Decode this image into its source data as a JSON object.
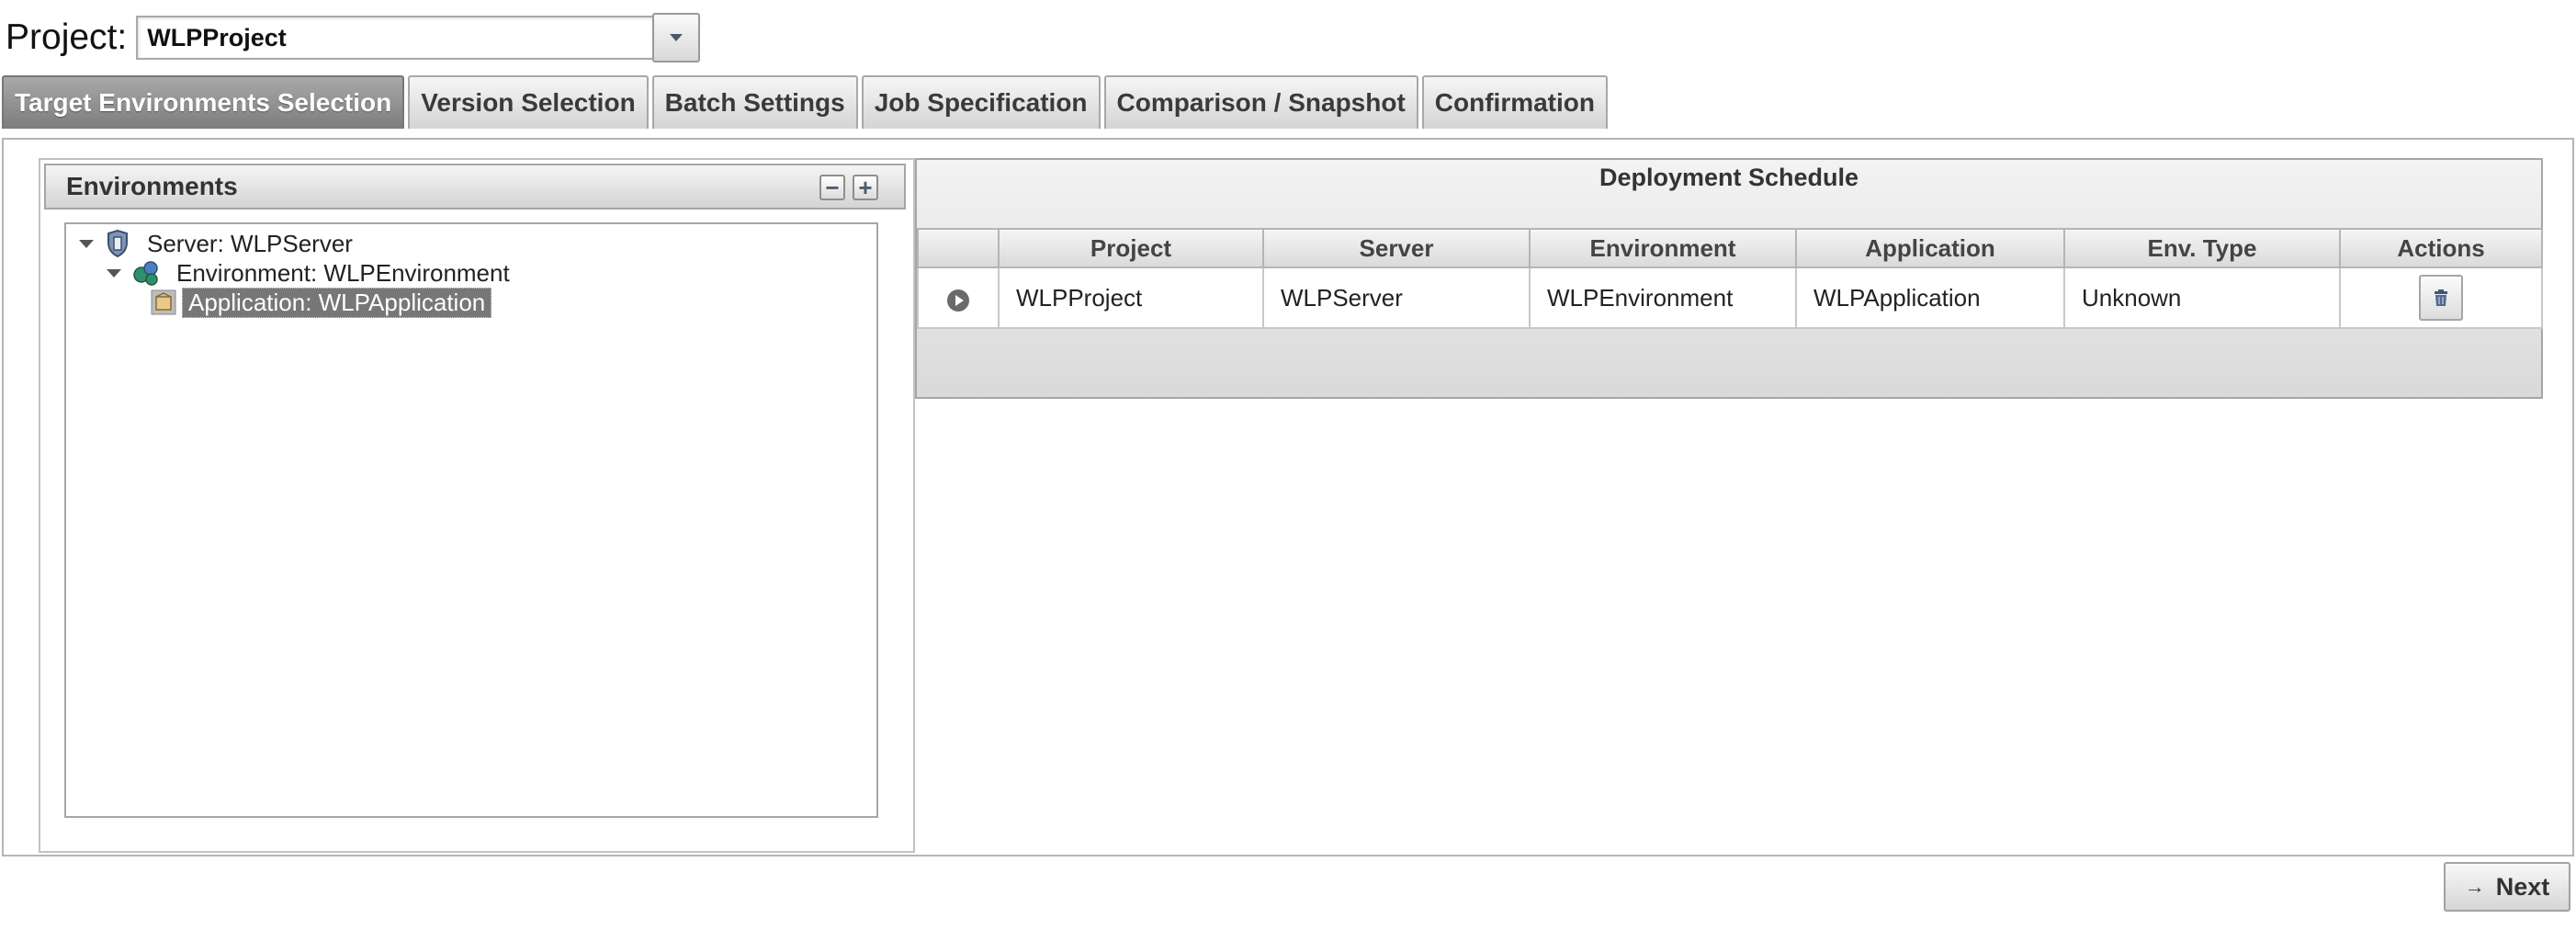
{
  "project": {
    "label": "Project:",
    "value": "WLPProject"
  },
  "tabs": [
    {
      "label": "Target Environments Selection",
      "active": true
    },
    {
      "label": "Version Selection",
      "active": false
    },
    {
      "label": "Batch Settings",
      "active": false
    },
    {
      "label": "Job Specification",
      "active": false
    },
    {
      "label": "Comparison / Snapshot",
      "active": false
    },
    {
      "label": "Confirmation",
      "active": false
    }
  ],
  "environments": {
    "title": "Environments",
    "collapse_label": "−",
    "expand_label": "+",
    "tree": {
      "server": "Server: WLPServer",
      "environment": "Environment: WLPEnvironment",
      "application": "Application: WLPApplication"
    }
  },
  "schedule": {
    "title": "Deployment Schedule",
    "columns": [
      "Project",
      "Server",
      "Environment",
      "Application",
      "Env. Type",
      "Actions"
    ],
    "rows": [
      {
        "project": "WLPProject",
        "server": "WLPServer",
        "environment": "WLPEnvironment",
        "application": "WLPApplication",
        "env_type": "Unknown"
      }
    ]
  },
  "next_label": "Next",
  "icons": {
    "dropdown": "chevron-down-icon",
    "server": "server-shield-icon",
    "environment": "environment-globe-icon",
    "application": "application-package-icon",
    "row": "play-circle-icon",
    "delete": "trash-icon",
    "next": "arrow-right-icon"
  }
}
